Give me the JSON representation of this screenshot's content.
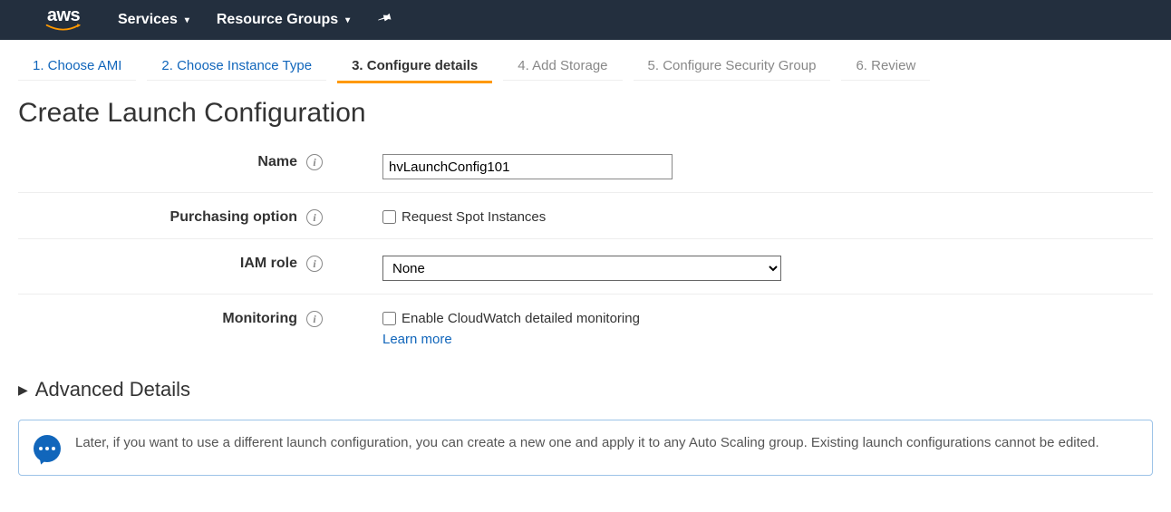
{
  "topnav": {
    "logo_text": "aws",
    "services": "Services",
    "resource_groups": "Resource Groups"
  },
  "tabs": [
    {
      "label": "1. Choose AMI",
      "state": "link"
    },
    {
      "label": "2. Choose Instance Type",
      "state": "link"
    },
    {
      "label": "3. Configure details",
      "state": "active"
    },
    {
      "label": "4. Add Storage",
      "state": "disabled"
    },
    {
      "label": "5. Configure Security Group",
      "state": "disabled"
    },
    {
      "label": "6. Review",
      "state": "disabled"
    }
  ],
  "page_title": "Create Launch Configuration",
  "form": {
    "name_label": "Name",
    "name_value": "hvLaunchConfig101",
    "purchasing_label": "Purchasing option",
    "purchasing_checkbox": "Request Spot Instances",
    "iam_label": "IAM role",
    "iam_selected": "None",
    "monitoring_label": "Monitoring",
    "monitoring_checkbox": "Enable CloudWatch detailed monitoring",
    "learn_more": "Learn more"
  },
  "advanced_label": "Advanced Details",
  "info_box": "Later, if you want to use a different launch configuration, you can create a new one and apply it to any Auto Scaling group. Existing launch configurations cannot be edited."
}
